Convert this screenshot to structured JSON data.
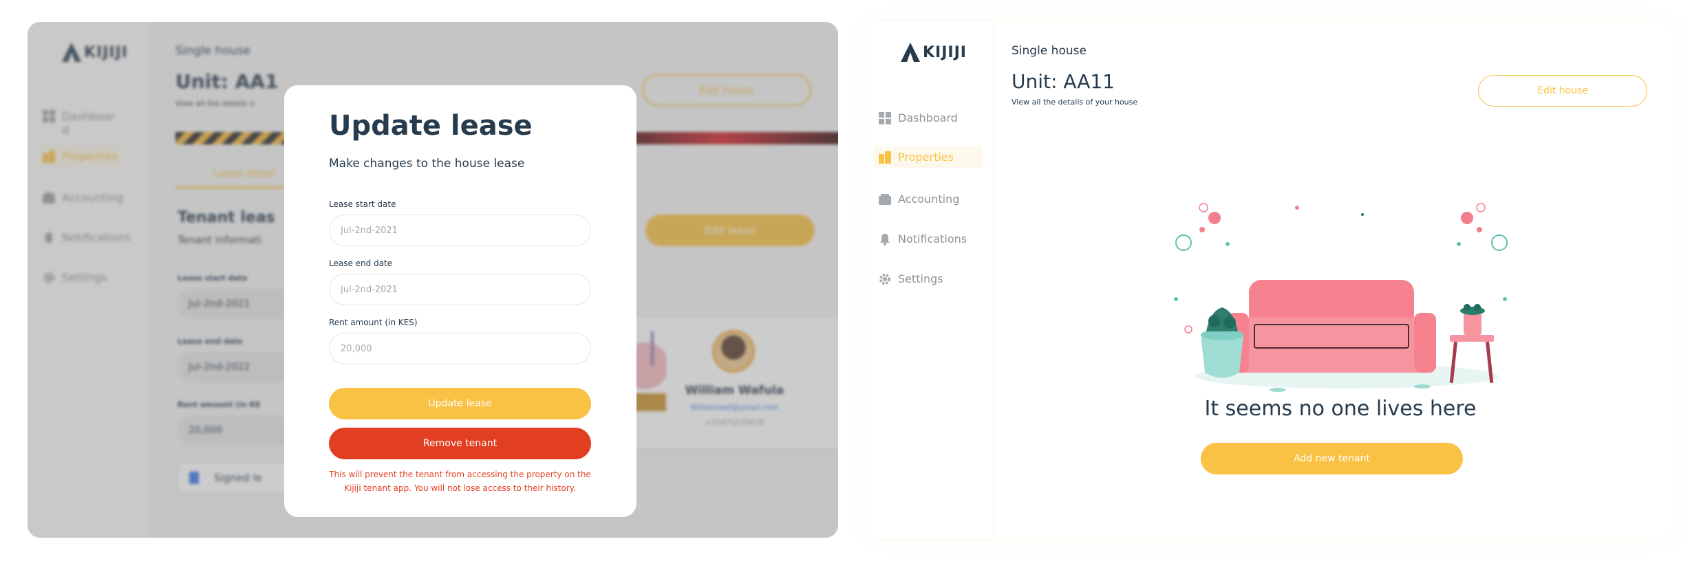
{
  "app": {
    "brand": "KIJIJI"
  },
  "sidebar": {
    "items": [
      {
        "label": "Dashboard",
        "icon": "dashboard-icon"
      },
      {
        "label": "Properties",
        "icon": "building-icon"
      },
      {
        "label": "Accounting",
        "icon": "wallet-icon"
      },
      {
        "label": "Notifications",
        "icon": "bell-icon"
      },
      {
        "label": "Settings",
        "icon": "gear-icon"
      }
    ],
    "left_dashboard_line1": "Dashboar",
    "left_dashboard_line2": "d"
  },
  "house": {
    "type": "Single house",
    "unit": "Unit: AA11",
    "unit_partial": "Unit: AA1",
    "subtitle": "View all the details of your house",
    "subtitle_partial": "View all the details o",
    "edit_house_label": "Edit house"
  },
  "lease_view": {
    "tab_label": "Lease detail",
    "title": "Tenant leas",
    "subtitle": "Tenant informati",
    "edit_lease_label": "Edit lease",
    "fields": [
      {
        "label": "Lease start date",
        "value": "Jul-2nd-2021"
      },
      {
        "label": "Lease end date",
        "value": "Jul-2nd-2022"
      },
      {
        "label": "Rent amount (in KE",
        "value": "20,000"
      }
    ],
    "signed_label": "Signed le",
    "tenant": {
      "name": "William Wafula",
      "email": "Williamwaf@ymail.com",
      "phone": "+25471235678"
    }
  },
  "modal": {
    "title": "Update lease",
    "subtitle": "Make changes to the house lease",
    "fields": [
      {
        "label": "Lease start date",
        "placeholder": "Jul-2nd-2021"
      },
      {
        "label": "Lease end date",
        "placeholder": "Jul-2nd-2021"
      },
      {
        "label": "Rent amount (in KES)",
        "placeholder": "20,000"
      }
    ],
    "update_label": "Update lease",
    "remove_label": "Remove tenant",
    "warning": "This will prevent the tenant from accessing the property on the Kijiji tenant app. You will not lose access to their history."
  },
  "empty_state": {
    "message": "It seems no one lives here",
    "add_tenant_label": "Add new tenant"
  },
  "colors": {
    "accent": "#f9c244",
    "danger": "#e23f22",
    "text": "#263b4d",
    "muted": "#8c939a"
  }
}
